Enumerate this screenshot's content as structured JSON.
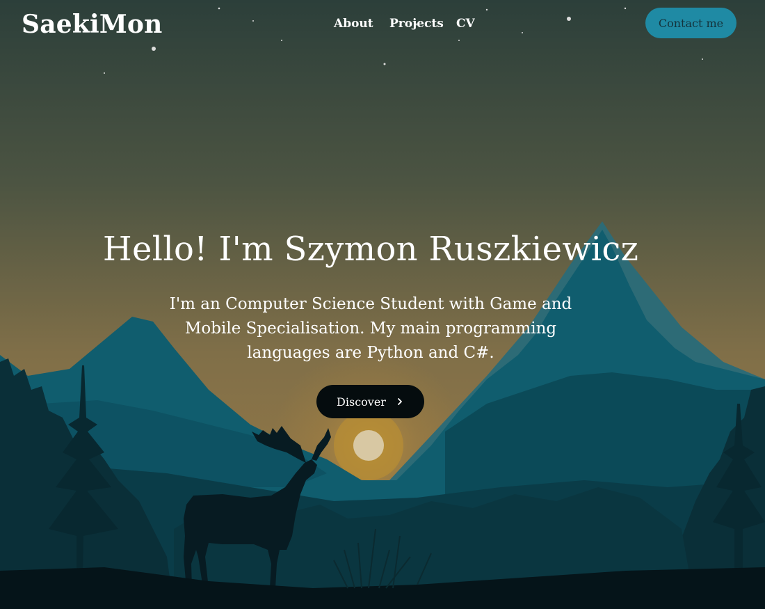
{
  "header": {
    "logo": "SaekiMon",
    "nav": {
      "about": "About",
      "projects": "Projects",
      "cv": "CV"
    },
    "contact_label": "Contact me"
  },
  "hero": {
    "title": "Hello! I'm Szymon Ruszkiewicz",
    "subtitle": "I'm an Computer Science Student with Game and Mobile Specialisation. My main programming languages are Python and C#.",
    "discover_label": "Discover",
    "discover_icon": "chevron-right-icon"
  },
  "colors": {
    "accent": "#1f8aa4",
    "button_dark": "#050c0e",
    "sky_top": "#2c3f3a",
    "sky_horizon": "#8a7649",
    "mountain": "#0f5a6b",
    "foreground": "#071a20"
  }
}
